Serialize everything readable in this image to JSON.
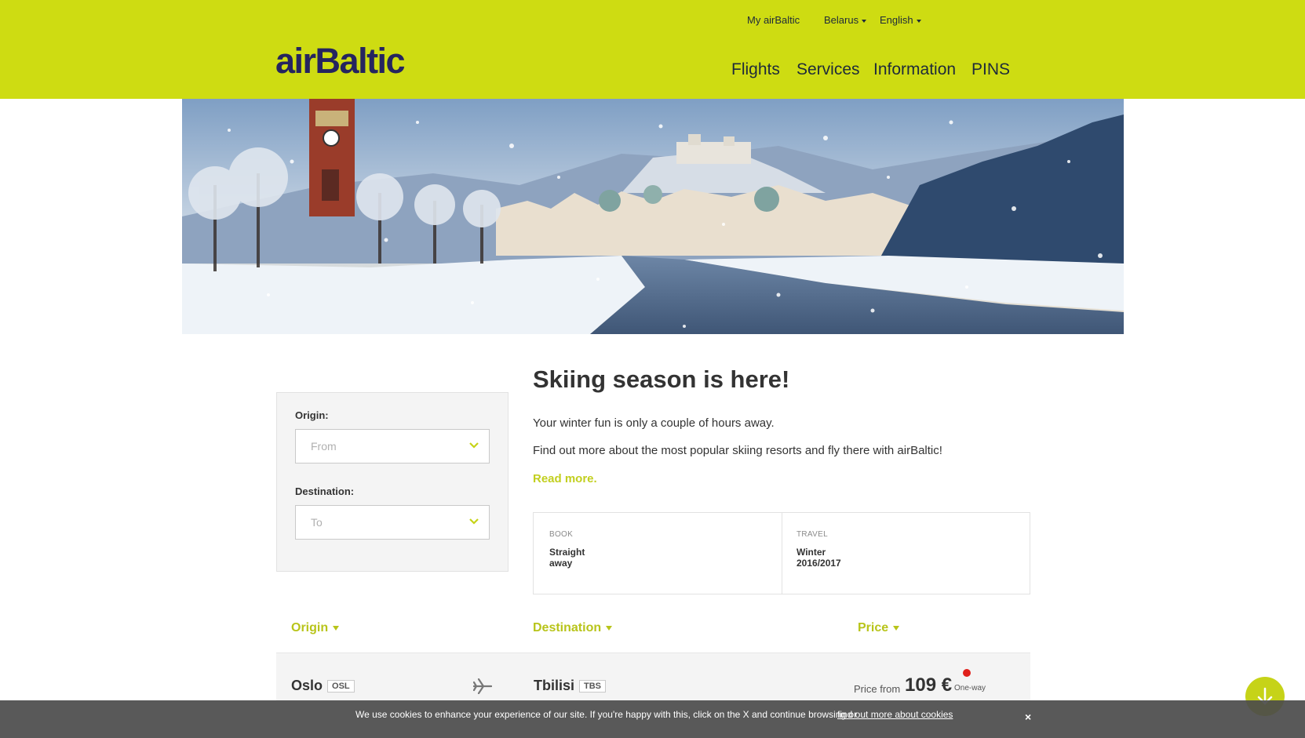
{
  "header": {
    "top_links": {
      "my_account": "My airBaltic",
      "country": "Belarus",
      "language": "English"
    },
    "logo_text": "airBaltic",
    "nav": [
      "Flights",
      "Services",
      "Information",
      "PINS"
    ]
  },
  "search": {
    "origin_label": "Origin:",
    "origin_placeholder": "From",
    "destination_label": "Destination:",
    "destination_placeholder": "To"
  },
  "content": {
    "title": "Skiing season is here!",
    "para1": "Your winter fun is only a couple of hours away.",
    "para2": "Find out more about the most popular skiing resorts and fly there with airBaltic!",
    "read_more": "Read more."
  },
  "info": {
    "book_key": "BOOK",
    "book_value": "Straight away",
    "travel_key": "TRAVEL",
    "travel_value": "Winter 2016/2017"
  },
  "table": {
    "headers": {
      "origin": "Origin",
      "destination": "Destination",
      "price": "Price"
    },
    "rows": [
      {
        "origin": "Oslo",
        "origin_code": "OSL",
        "destination": "Tbilisi",
        "destination_code": "TBS",
        "price_prefix": "Price from",
        "price": "109 €",
        "fare_type": "One-way"
      }
    ]
  },
  "cookie": {
    "text": "We use cookies to enhance your experience of our site. If you're happy with this, click on the X and continue browsing or",
    "link": "find out more about cookies",
    "end": ".",
    "close": "×"
  },
  "colors": {
    "brand_lime": "#cedc12",
    "brand_navy": "#25245f",
    "accent_text": "#b8c41a"
  },
  "icons": {
    "select_chevron": "chevron-down-icon",
    "route": "plane-icon",
    "scroll": "arrow-down-icon",
    "cookie_close": "close-icon"
  }
}
